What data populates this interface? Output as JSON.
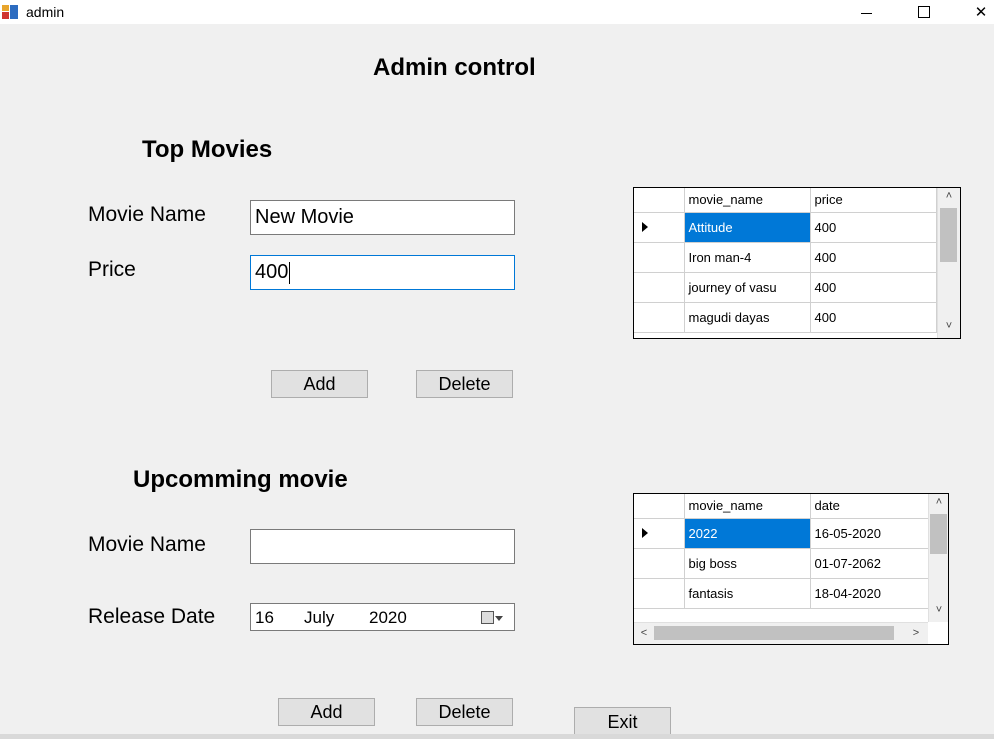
{
  "window": {
    "title": "admin"
  },
  "form": {
    "title": "Admin control"
  },
  "top_movies": {
    "heading": "Top Movies",
    "movie_name_label": "Movie Name",
    "movie_name_value": "New Movie",
    "price_label": "Price",
    "price_value": "400",
    "add_label": "Add",
    "delete_label": "Delete",
    "grid": {
      "columns": [
        "movie_name",
        "price"
      ],
      "rows": [
        [
          "Attitude",
          "400"
        ],
        [
          "Iron man-4",
          "400"
        ],
        [
          "journey of vasu",
          "400"
        ],
        [
          "magudi dayas",
          "400"
        ]
      ]
    }
  },
  "upcoming": {
    "heading": "Upcomming movie",
    "movie_name_label": "Movie Name",
    "movie_name_value": "",
    "release_date_label": "Release Date",
    "date_day": "16",
    "date_month": "July",
    "date_year": "2020",
    "add_label": "Add",
    "delete_label": "Delete",
    "grid": {
      "columns": [
        "movie_name",
        "date"
      ],
      "rows": [
        [
          "2022",
          "16-05-2020"
        ],
        [
          "big boss",
          "01-07-2062"
        ],
        [
          "fantasis",
          "18-04-2020"
        ]
      ]
    }
  },
  "exit_label": "Exit",
  "icons": {
    "scroll_up": "▲",
    "scroll_down": "▼",
    "scroll_left": "<",
    "scroll_right": ">",
    "close": "✕"
  }
}
